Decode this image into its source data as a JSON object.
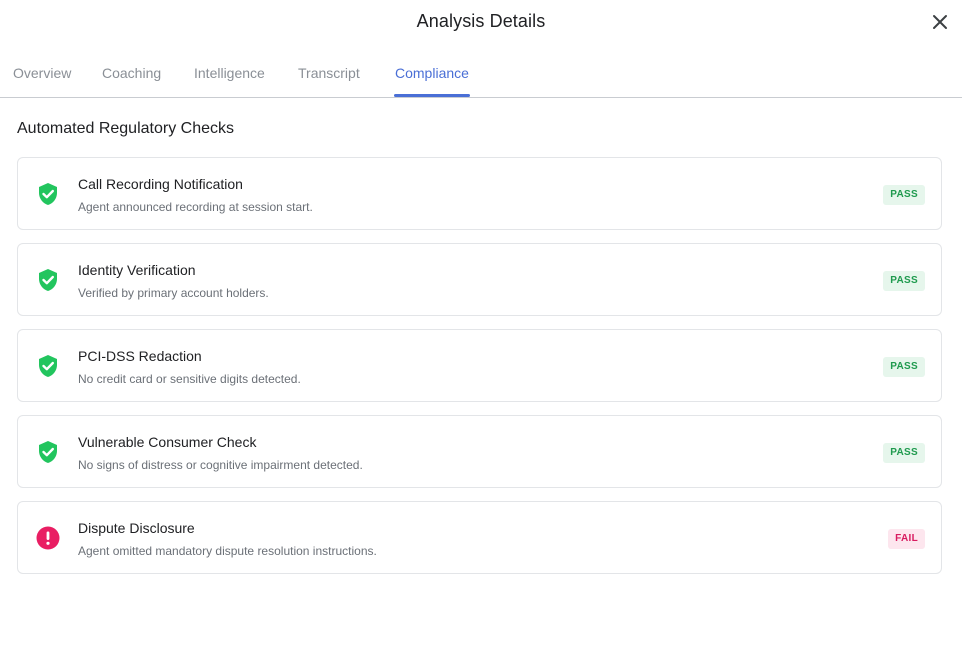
{
  "dialog": {
    "title": "Analysis Details"
  },
  "tabs": [
    {
      "label": "Overview",
      "active": false
    },
    {
      "label": "Coaching",
      "active": false
    },
    {
      "label": "Intelligence",
      "active": false
    },
    {
      "label": "Transcript",
      "active": false
    },
    {
      "label": "Compliance",
      "active": true
    }
  ],
  "section": {
    "title": "Automated Regulatory Checks"
  },
  "checks": [
    {
      "name": "Call Recording Notification",
      "description": "Agent announced recording at session start.",
      "status": "PASS",
      "icon": "shield-check-icon"
    },
    {
      "name": "Identity Verification",
      "description": "Verified by primary account holders.",
      "status": "PASS",
      "icon": "shield-check-icon"
    },
    {
      "name": "PCI-DSS Redaction",
      "description": "No credit card or sensitive digits detected.",
      "status": "PASS",
      "icon": "shield-check-icon"
    },
    {
      "name": "Vulnerable Consumer Check",
      "description": "No signs of distress or cognitive impairment detected.",
      "status": "PASS",
      "icon": "shield-check-icon"
    },
    {
      "name": "Dispute Disclosure",
      "description": "Agent omitted mandatory dispute resolution instructions.",
      "status": "FAIL",
      "icon": "error-icon"
    }
  ],
  "colors": {
    "accent": "#4a6fd6",
    "pass_icon": "#22c55e",
    "pass_badge_bg": "#e6f6ec",
    "pass_badge_text": "#1f9a4e",
    "fail_icon": "#e91e63",
    "fail_badge_bg": "#fde6ee",
    "fail_badge_text": "#d81b60"
  }
}
